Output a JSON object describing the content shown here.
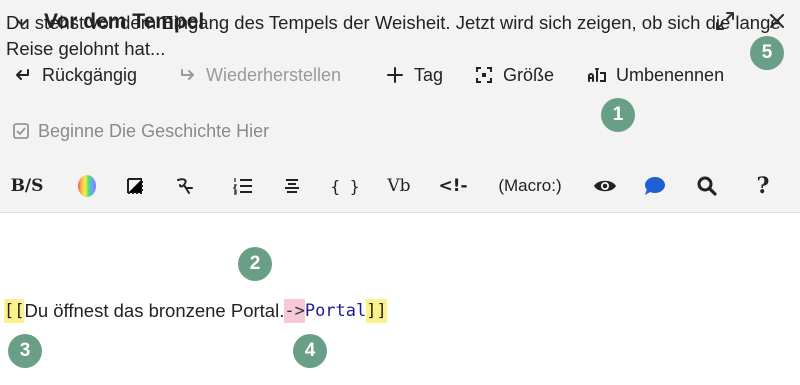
{
  "header": {
    "title": "Vor dem Tempel"
  },
  "toolbar": {
    "undo": "Rückgängig",
    "redo": "Wiederherstellen",
    "tag": "Tag",
    "size": "Größe",
    "rename": "Umbenennen"
  },
  "start_story": {
    "label": "Beginne Die Geschichte Hier"
  },
  "format_bar": {
    "bold_strike": "B/S",
    "code": "{ }",
    "verbatim": "Vb",
    "comment": "<!-",
    "macro": "(Macro:)",
    "help": "?"
  },
  "passage": {
    "text": "Du stehst vor dem Eingang des Tempels der Weisheit. Jetzt wird sich zeigen, ob sich die lange Reise gelohnt hat...",
    "link_open": "[[",
    "link_text": "Du öffnest das bronzene Portal.",
    "link_arrow": "->",
    "link_target": "Portal",
    "link_close": "]]"
  },
  "badges": [
    "1",
    "2",
    "3",
    "4",
    "5"
  ],
  "colors": {
    "badge": "#6a9f87",
    "link_bracket_highlight": "#fbf28b",
    "link_arrow_highlight": "#f7c9d7",
    "comment_icon": "#1f5fd1"
  }
}
